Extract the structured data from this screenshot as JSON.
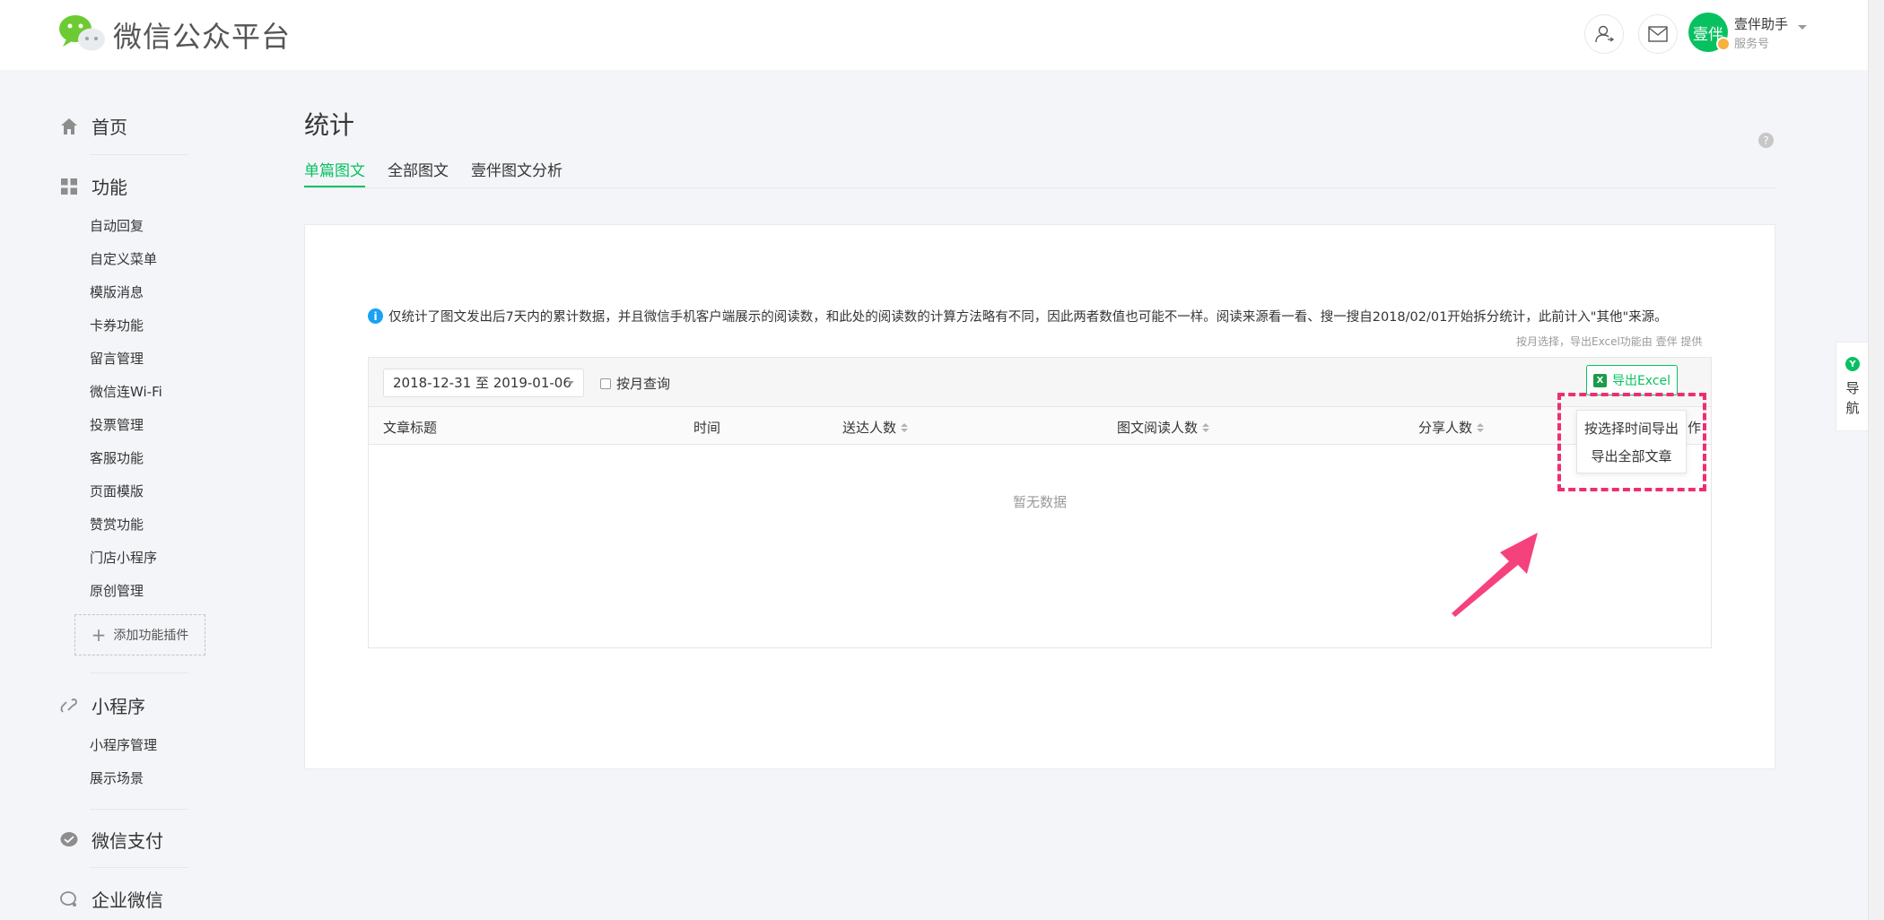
{
  "header": {
    "logo_text": "微信公众平台",
    "account_name": "壹伴助手",
    "account_type": "服务号",
    "avatar_text": "壹伴"
  },
  "sidebar": {
    "home": "首页",
    "features": {
      "label": "功能",
      "items": [
        "自动回复",
        "自定义菜单",
        "模版消息",
        "卡券功能",
        "留言管理",
        "微信连Wi-Fi",
        "投票管理",
        "客服功能",
        "页面模版",
        "赞赏功能",
        "门店小程序",
        "原创管理"
      ]
    },
    "add_plugin": "添加功能插件",
    "mini_program": {
      "label": "小程序",
      "items": [
        "小程序管理",
        "展示场景"
      ]
    },
    "wechat_pay": "微信支付",
    "work_wechat": "企业微信"
  },
  "main": {
    "title": "统计",
    "tabs": [
      {
        "label": "单篇图文",
        "active": true
      },
      {
        "label": "全部图文",
        "active": false
      },
      {
        "label": "壹伴图文分析",
        "active": false
      }
    ],
    "notice": "仅统计了图文发出后7天内的累计数据，并且微信手机客户端展示的阅读数，和此处的阅读数的计算方法略有不同，因此两者数值也可能不一样。阅读来源看一看、搜一搜自2018/02/01开始拆分统计，此前计入\"其他\"来源。",
    "provider_note": "按月选择，导出Excel功能由 壹伴 提供",
    "date_range": "2018-12-31 至 2019-01-06",
    "monthly_query": "按月查询",
    "export_button": "导出Excel",
    "export_options": [
      "按选择时间导出",
      "导出全部文章"
    ],
    "columns": [
      "文章标题",
      "时间",
      "送达人数",
      "图文阅读人数",
      "分享人数",
      "作"
    ],
    "empty_text": "暂无数据"
  },
  "side_nav": {
    "label_1": "导",
    "label_2": "航"
  },
  "colors": {
    "accent": "#07c160",
    "highlight": "#ee2e72",
    "info": "#1aa1f5"
  }
}
